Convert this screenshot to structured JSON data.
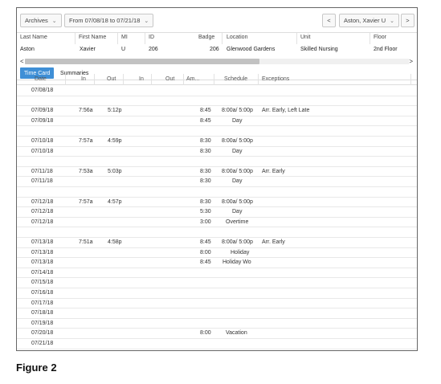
{
  "toolbar": {
    "archives_label": "Archives",
    "range_label": "From 07/08/18 to 07/21/18",
    "prev_label": "<",
    "employee_label": "Aston, Xavier U",
    "next_label": ">"
  },
  "employee": {
    "headers": [
      "Last Name",
      "First Name",
      "MI",
      "ID",
      "Badge",
      "Location",
      "Unit",
      "Floor"
    ],
    "values": [
      "Aston",
      "Xavier",
      "U",
      "206",
      "206",
      "Glenwood Gardens",
      "Skilled Nursing",
      "2nd Floor"
    ]
  },
  "scroll": {
    "left": "<",
    "right": ">"
  },
  "tabs": [
    {
      "label": "Time Card",
      "active": true
    },
    {
      "label": "Summaries",
      "active": false
    }
  ],
  "timecard": {
    "headers": [
      "Date",
      "In",
      "Out",
      "In",
      "Out",
      "Am...",
      "Schedule",
      "Exceptions"
    ],
    "rows": [
      [
        "07/08/18",
        "",
        "",
        "",
        "",
        "",
        "",
        ""
      ],
      [
        "",
        "",
        "",
        "",
        "",
        "",
        "",
        ""
      ],
      [
        "07/09/18",
        "7:56a",
        "5:12p",
        "",
        "",
        "8:45",
        "8:00a/ 5:00p",
        "Arr. Early, Left Late"
      ],
      [
        "07/09/18",
        "",
        "",
        "",
        "",
        "8:45",
        "Day",
        ""
      ],
      [
        "",
        "",
        "",
        "",
        "",
        "",
        "",
        ""
      ],
      [
        "07/10/18",
        "7:57a",
        "4:59p",
        "",
        "",
        "8:30",
        "8:00a/ 5:00p",
        ""
      ],
      [
        "07/10/18",
        "",
        "",
        "",
        "",
        "8:30",
        "Day",
        ""
      ],
      [
        "",
        "",
        "",
        "",
        "",
        "",
        "",
        ""
      ],
      [
        "07/11/18",
        "7:53a",
        "5:03p",
        "",
        "",
        "8:30",
        "8:00a/ 5:00p",
        "Arr. Early"
      ],
      [
        "07/11/18",
        "",
        "",
        "",
        "",
        "8:30",
        "Day",
        ""
      ],
      [
        "",
        "",
        "",
        "",
        "",
        "",
        "",
        ""
      ],
      [
        "07/12/18",
        "7:57a",
        "4:57p",
        "",
        "",
        "8:30",
        "8:00a/ 5:00p",
        ""
      ],
      [
        "07/12/18",
        "",
        "",
        "",
        "",
        "5:30",
        "Day",
        ""
      ],
      [
        "07/12/18",
        "",
        "",
        "",
        "",
        "3:00",
        "Overtime",
        ""
      ],
      [
        "",
        "",
        "",
        "",
        "",
        "",
        "",
        ""
      ],
      [
        "07/13/18",
        "7:51a",
        "4:58p",
        "",
        "",
        "8:45",
        "8:00a/ 5:00p",
        "Arr. Early"
      ],
      [
        "07/13/18",
        "",
        "",
        "",
        "",
        "8:00",
        "Holiday",
        ""
      ],
      [
        "07/13/18",
        "",
        "",
        "",
        "",
        "8:45",
        "Holiday Wo",
        ""
      ],
      [
        "07/14/18",
        "",
        "",
        "",
        "",
        "",
        "",
        ""
      ],
      [
        "07/15/18",
        "",
        "",
        "",
        "",
        "",
        "",
        ""
      ],
      [
        "07/16/18",
        "",
        "",
        "",
        "",
        "",
        "",
        ""
      ],
      [
        "07/17/18",
        "",
        "",
        "",
        "",
        "",
        "",
        ""
      ],
      [
        "07/18/18",
        "",
        "",
        "",
        "",
        "",
        "",
        ""
      ],
      [
        "07/19/18",
        "",
        "",
        "",
        "",
        "",
        "",
        ""
      ],
      [
        "07/20/18",
        "",
        "",
        "",
        "",
        "8:00",
        "Vacation",
        ""
      ],
      [
        "07/21/18",
        "",
        "",
        "",
        "",
        "",
        "",
        ""
      ]
    ]
  },
  "caption": "Figure 2",
  "colors": {
    "active_tab": "#3f8fd6",
    "border": "#666666"
  }
}
